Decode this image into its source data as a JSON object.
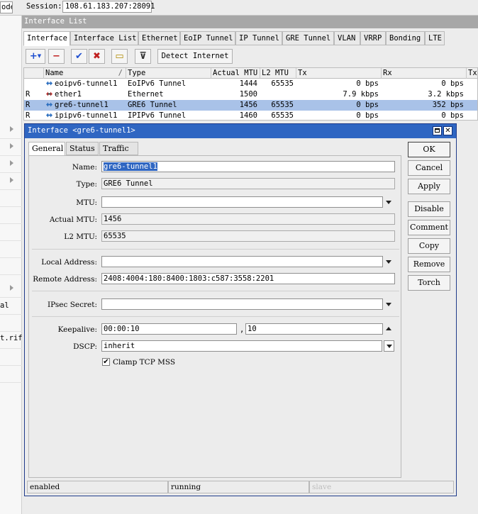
{
  "topbar": {
    "mode_text": "ode",
    "session_label": "Session:",
    "session_value": "108.61.183.207:28091"
  },
  "leftstrip": {
    "text_al": "al",
    "text_rif": "t.rif"
  },
  "interface_list": {
    "title": "Interface List",
    "tabs": [
      "Interface",
      "Interface List",
      "Ethernet",
      "EoIP Tunnel",
      "IP Tunnel",
      "GRE Tunnel",
      "VLAN",
      "VRRP",
      "Bonding",
      "LTE"
    ],
    "toolbar": {
      "add": "+",
      "remove": "−",
      "enable": "✔",
      "disable": "✖",
      "comment": "▭",
      "filter": "⊽",
      "detect_label": "Detect Internet"
    },
    "columns": [
      "Name",
      "Type",
      "Actual MTU",
      "L2 MTU",
      "Tx",
      "Rx",
      "Tx"
    ],
    "rows": [
      {
        "flag": "",
        "name": "eoipv6-tunnel1",
        "type": "EoIPv6 Tunnel",
        "mtu": "1444",
        "l2mtu": "65535",
        "tx": "0 bps",
        "rx": "0 bps",
        "selected": false
      },
      {
        "flag": "R",
        "name": "ether1",
        "type": "Ethernet",
        "mtu": "1500",
        "l2mtu": "",
        "tx": "7.9 kbps",
        "rx": "3.2 kbps",
        "selected": false
      },
      {
        "flag": "R",
        "name": "gre6-tunnel1",
        "type": "GRE6 Tunnel",
        "mtu": "1456",
        "l2mtu": "65535",
        "tx": "0 bps",
        "rx": "352 bps",
        "selected": true
      },
      {
        "flag": "R",
        "name": "ipipv6-tunnel1",
        "type": "IPIPv6 Tunnel",
        "mtu": "1460",
        "l2mtu": "65535",
        "tx": "0 bps",
        "rx": "0 bps",
        "selected": false
      }
    ]
  },
  "dialog": {
    "title": "Interface <gre6-tunnel1>",
    "tabs": [
      "General",
      "Status",
      "Traffic"
    ],
    "fields": {
      "name_label": "Name:",
      "name_value": "gre6-tunnel1",
      "type_label": "Type:",
      "type_value": "GRE6 Tunnel",
      "mtu_label": "MTU:",
      "mtu_value": "",
      "actual_mtu_label": "Actual MTU:",
      "actual_mtu_value": "1456",
      "l2mtu_label": "L2 MTU:",
      "l2mtu_value": "65535",
      "local_label": "Local Address:",
      "local_value": "",
      "remote_label": "Remote Address:",
      "remote_value": "2408:4004:180:8400:1803:c587:3558:2201",
      "ipsec_label": "IPsec Secret:",
      "ipsec_value": "",
      "keepalive_label": "Keepalive:",
      "keepalive_interval": "00:00:10",
      "keepalive_sep": ",",
      "keepalive_retries": "10",
      "dscp_label": "DSCP:",
      "dscp_value": "inherit",
      "clamp_label": "Clamp TCP MSS",
      "clamp_checked": "✔"
    },
    "buttons": [
      "OK",
      "Cancel",
      "Apply",
      "Disable",
      "Comment",
      "Copy",
      "Remove",
      "Torch"
    ],
    "status": [
      "enabled",
      "running",
      "slave"
    ]
  },
  "colors": {
    "titlebar_active": "#2f66c2",
    "selection": "#a9c2e8",
    "titlebar_inactive": "#a7a7a7"
  }
}
